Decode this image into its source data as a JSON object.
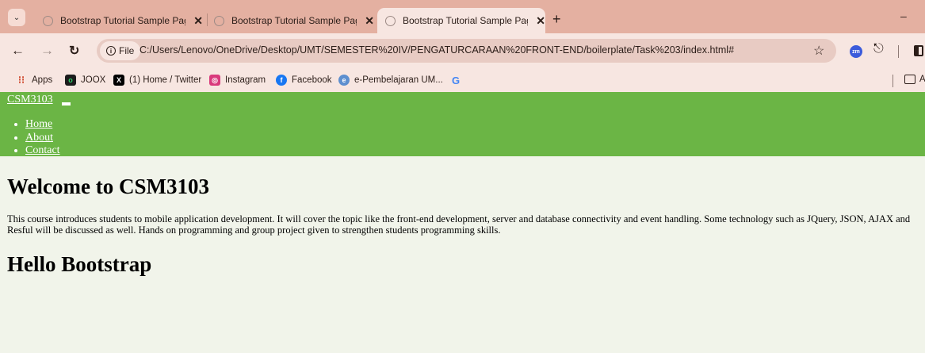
{
  "browser": {
    "tabs": [
      {
        "title": "Bootstrap Tutorial Sample Page",
        "active": false
      },
      {
        "title": "Bootstrap Tutorial Sample Page",
        "active": false
      },
      {
        "title": "Bootstrap Tutorial Sample Page",
        "active": true
      }
    ],
    "new_tab_glyph": "+",
    "minimize_glyph": "–",
    "address": {
      "scheme_label": "File",
      "url": "C:/Users/Lenovo/OneDrive/Desktop/UMT/SEMESTER%20IV/PENGATURCARAAN%20FRONT-END/boilerplate/Task%203/index.html#"
    },
    "extension_zm_label": "zm",
    "bookmarks": [
      {
        "label": "Apps",
        "icon": "apps-grid-icon"
      },
      {
        "label": "JOOX",
        "icon": "joox-icon"
      },
      {
        "label": "(1) Home / Twitter",
        "icon": "x-twitter-icon"
      },
      {
        "label": "Instagram",
        "icon": "instagram-icon"
      },
      {
        "label": "Facebook",
        "icon": "facebook-icon"
      },
      {
        "label": "e-Pembelajaran UM...",
        "icon": "elearning-icon"
      },
      {
        "label": "",
        "icon": "google-icon"
      }
    ],
    "bookmarks_folder_label": "A"
  },
  "page": {
    "brand": "CSM3103",
    "nav_links": [
      "Home",
      "About",
      "Contact"
    ],
    "heading": "Welcome to CSM3103",
    "intro": "This course introduces students to mobile application development. It will cover the topic like the front-end development, server and database connectivity and event handling. Some technology such as JQuery, JSON, AJAX and Resful will be discussed as well. Hands on programming and group project given to strengthen students programming skills.",
    "subheading": "Hello Bootstrap"
  },
  "colors": {
    "tabstrip": "#e4b0a1",
    "toolbar": "#f7e6e1",
    "navbar": "#6bb545",
    "page_background": "#f1f4ea"
  }
}
